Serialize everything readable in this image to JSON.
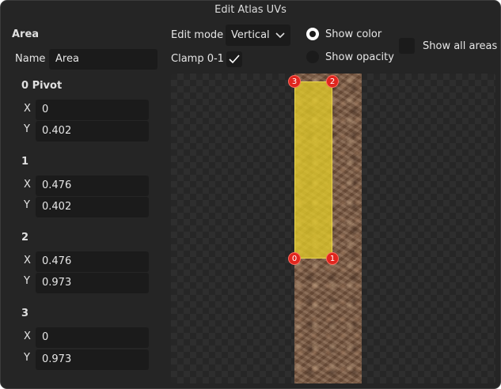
{
  "window": {
    "title": "Edit Atlas UVs"
  },
  "area": {
    "heading": "Area",
    "name_label": "Name",
    "name_value": "Area"
  },
  "points": [
    {
      "title": "0 Pivot",
      "x_label": "X",
      "x": "0",
      "y_label": "Y",
      "y": "0.402"
    },
    {
      "title": "1",
      "x_label": "X",
      "x": "0.476",
      "y_label": "Y",
      "y": "0.402"
    },
    {
      "title": "2",
      "x_label": "X",
      "x": "0.476",
      "y_label": "Y",
      "y": "0.973"
    },
    {
      "title": "3",
      "x_label": "X",
      "x": "0",
      "y_label": "Y",
      "y": "0.973"
    }
  ],
  "toolbar": {
    "edit_mode_label": "Edit mode",
    "edit_mode_value": "Vertical",
    "clamp_label": "Clamp 0-1",
    "clamp_checked": true,
    "show_color_label": "Show color",
    "show_opacity_label": "Show opacity",
    "show_all_areas_label": "Show all areas"
  },
  "handles": {
    "h0": "0",
    "h1": "1",
    "h2": "2",
    "h3": "3"
  },
  "colors": {
    "handle": "#e0261e",
    "area_fill": "#e4cd28",
    "panel_bg": "#252525",
    "field_bg": "#1b1b1b"
  }
}
